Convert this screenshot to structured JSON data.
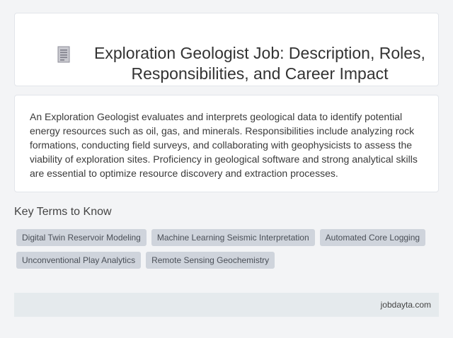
{
  "header": {
    "icon": "document-icon",
    "title": "Exploration Geologist Job: Description, Roles, Responsibilities, and Career Impact"
  },
  "description": {
    "text": "An Exploration Geologist evaluates and interprets geological data to identify potential energy resources such as oil, gas, and minerals. Responsibilities include analyzing rock formations, conducting field surveys, and collaborating with geophysicists to assess the viability of exploration sites. Proficiency in geological software and strong analytical skills are essential to optimize resource discovery and extraction processes."
  },
  "key_terms": {
    "heading": "Key Terms to Know",
    "tags": [
      "Digital Twin Reservoir Modeling",
      "Machine Learning Seismic Interpretation",
      "Automated Core Logging",
      "Unconventional Play Analytics",
      "Remote Sensing Geochemistry"
    ]
  },
  "footer": {
    "site": "jobdayta.com"
  },
  "colors": {
    "background": "#f3f4f6",
    "card": "#ffffff",
    "tag_background": "#cfd4dc",
    "footer_background": "#e5eaed"
  }
}
